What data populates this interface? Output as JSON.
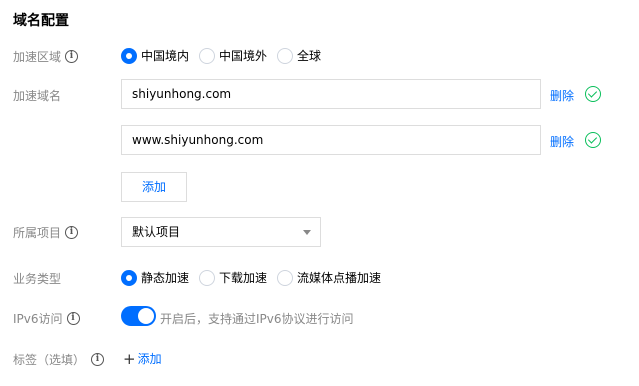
{
  "section_title": "域名配置",
  "accelerate_region": {
    "label": "加速区域",
    "options": [
      {
        "label": "中国境内",
        "checked": true
      },
      {
        "label": "中国境外",
        "checked": false
      },
      {
        "label": "全球",
        "checked": false
      }
    ]
  },
  "accelerate_domain": {
    "label": "加速域名",
    "domains": [
      "shiyunhong.com",
      "www.shiyunhong.com"
    ],
    "delete_label": "删除",
    "add_label": "添加"
  },
  "project": {
    "label": "所属项目",
    "selected": "默认项目"
  },
  "business_type": {
    "label": "业务类型",
    "options": [
      {
        "label": "静态加速",
        "checked": true
      },
      {
        "label": "下载加速",
        "checked": false
      },
      {
        "label": "流媒体点播加速",
        "checked": false
      }
    ]
  },
  "ipv6": {
    "label": "IPv6访问",
    "enabled": true,
    "hint": "开启后，支持通过IPv6协议进行访问"
  },
  "tags": {
    "label": "标签（选填）",
    "add_label": "添加"
  },
  "colors": {
    "accent": "#006eff",
    "success": "#0abf5b",
    "label_gray": "#888888"
  }
}
